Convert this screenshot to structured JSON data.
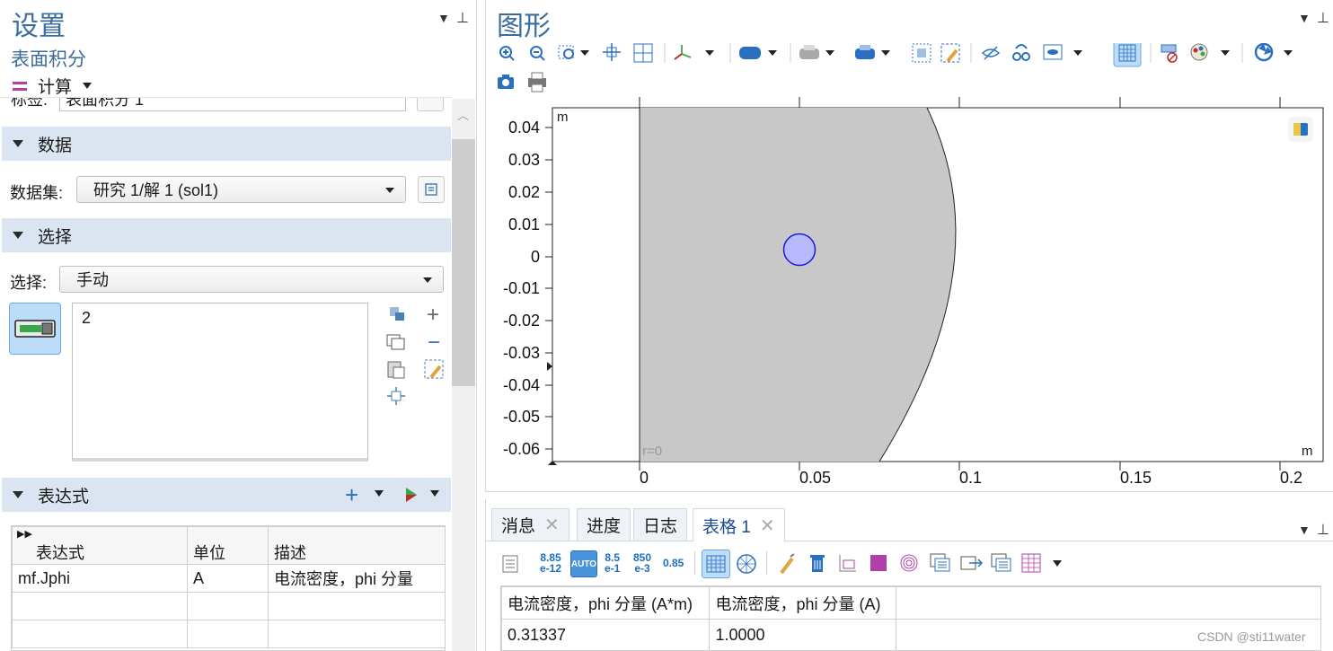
{
  "settings": {
    "title": "设置",
    "subtitle": "表面积分",
    "compute_label": "计算",
    "label_field_label": "标签:",
    "label_field_value": "表面积分 1",
    "data_section": "数据",
    "dataset_label": "数据集:",
    "dataset_value": "研究 1/解 1 (sol1)",
    "selection_section": "选择",
    "selection_label": "选择:",
    "selection_value": "手动",
    "selection_list": [
      "2"
    ],
    "expression_section": "表达式",
    "expr_table": {
      "headers": [
        "表达式",
        "单位",
        "描述"
      ],
      "rows": [
        [
          "mf.Jphi",
          "A",
          "电流密度，phi 分量"
        ]
      ]
    }
  },
  "graphics": {
    "title": "图形",
    "axis_unit_y": "m",
    "axis_unit_x": "m",
    "r0_label": "r=0",
    "y_ticks": [
      "0.04",
      "0.03",
      "0.02",
      "0.01",
      "0",
      "-0.01",
      "-0.02",
      "-0.03",
      "-0.04",
      "-0.05",
      "-0.06"
    ],
    "x_ticks": [
      "0",
      "0.05",
      "0.1",
      "0.15",
      "0.2"
    ],
    "colors": {
      "domain_fill": "#c8c8c8",
      "selected_circle": "#b9b9ff",
      "selected_edge": "#1a1ad6"
    }
  },
  "bottom": {
    "tabs": [
      {
        "label": "消息",
        "closable": true,
        "active": false
      },
      {
        "label": "进度",
        "closable": false,
        "active": false
      },
      {
        "label": "日志",
        "closable": false,
        "active": false
      },
      {
        "label": "表格 1",
        "closable": true,
        "active": true
      }
    ],
    "numfmt": [
      {
        "top": "8.85",
        "bottom": "e-12"
      },
      {
        "top": "AUTO",
        "bottom": ""
      },
      {
        "top": "8.5",
        "bottom": "e-1"
      },
      {
        "top": "850",
        "bottom": "e-3"
      },
      {
        "top": "0.85",
        "bottom": ""
      }
    ],
    "result_table": {
      "headers": [
        "电流密度，phi 分量 (A*m)",
        "电流密度，phi 分量 (A)"
      ],
      "rows": [
        [
          "0.31337",
          "1.0000"
        ]
      ]
    },
    "watermark": "CSDN @sti11water"
  }
}
